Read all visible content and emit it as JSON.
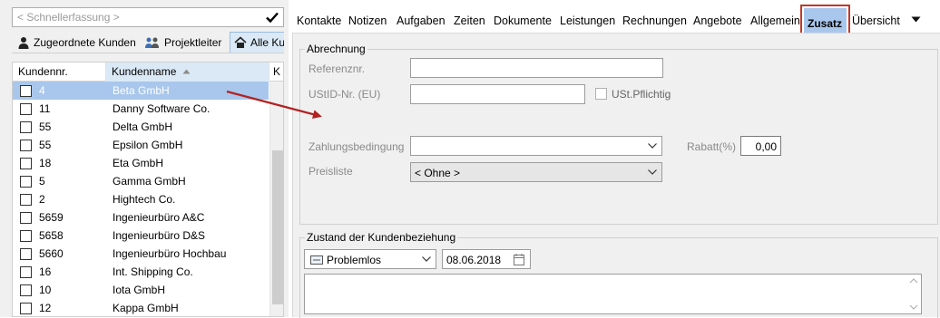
{
  "search": {
    "placeholder": "< Schnellerfassung >"
  },
  "filters": [
    {
      "label": "Zugeordnete Kunden",
      "icon": "person-icon"
    },
    {
      "label": "Projektleiter",
      "icon": "group-icon"
    },
    {
      "label": "Alle Ku",
      "icon": "home-icon"
    }
  ],
  "grid": {
    "columns": [
      "Kundennr.",
      "Kundenname",
      "K"
    ],
    "rows": [
      {
        "nr": "4",
        "name": "Beta GmbH",
        "selected": true
      },
      {
        "nr": "11",
        "name": "Danny Software Co."
      },
      {
        "nr": "55",
        "name": "Delta GmbH"
      },
      {
        "nr": "55",
        "name": "Epsilon GmbH"
      },
      {
        "nr": "18",
        "name": "Eta GmbH"
      },
      {
        "nr": "5",
        "name": "Gamma GmbH"
      },
      {
        "nr": "2",
        "name": "Hightech Co."
      },
      {
        "nr": "5659",
        "name": "Ingenieurbüro A&C"
      },
      {
        "nr": "5658",
        "name": "Ingenieurbüro D&S"
      },
      {
        "nr": "5660",
        "name": "Ingenieurbüro Hochbau"
      },
      {
        "nr": "16",
        "name": "Int. Shipping Co."
      },
      {
        "nr": "10",
        "name": "Iota GmbH"
      },
      {
        "nr": "12",
        "name": "Kappa GmbH"
      }
    ]
  },
  "tabs": [
    "Kontakte",
    "Notizen",
    "Aufgaben",
    "Zeiten",
    "Dokumente",
    "Leistungen",
    "Rechnungen",
    "Angebote",
    "Allgemein",
    "Zusatz",
    "Übersicht"
  ],
  "active_tab": "Zusatz",
  "abrechnung": {
    "title": "Abrechnung",
    "referenz_label": "Referenznr.",
    "referenz_value": "",
    "ustid_label": "UStID-Nr. (EU)",
    "ustid_value": "",
    "ust_pflichtig_label": "USt.Pflichtig",
    "zahlung_label": "Zahlungsbedingung",
    "zahlung_value": "",
    "rabatt_label": "Rabatt(%)",
    "rabatt_value": "0,00",
    "preisliste_label": "Preisliste",
    "preisliste_value": "< Ohne >"
  },
  "zustand": {
    "title": "Zustand der Kundenbeziehung",
    "status_value": "Problemlos",
    "date_value": "08.06.2018",
    "notes_value": ""
  },
  "colors": {
    "selection": "#a9c7ec",
    "annotation_red": "#c0392b",
    "panel_bg": "#f0f0f0"
  }
}
